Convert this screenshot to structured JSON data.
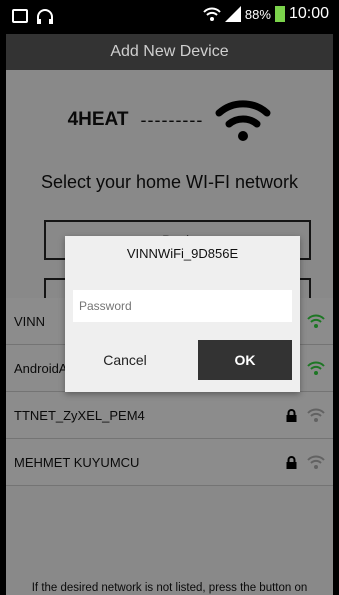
{
  "status_bar": {
    "battery": "88%",
    "time": "10:00",
    "icons": [
      "picture-icon",
      "headset-icon",
      "wifi-icon",
      "signal-icon",
      "battery-icon"
    ]
  },
  "app_bar": {
    "title": "Add New Device"
  },
  "header": {
    "brand": "4HEAT",
    "dashes": "---------",
    "wifi_icon": "wifi-icon"
  },
  "prompt": "Select your home WI-FI network",
  "buttons": {
    "first": "Back",
    "second": ""
  },
  "networks": [
    {
      "name": "VINN",
      "locked": true,
      "signal_color": "#2fbf3a"
    },
    {
      "name": "AndroidAP",
      "locked": true,
      "signal_color": "#2fbf3a"
    },
    {
      "name": "TTNET_ZyXEL_PEM4",
      "locked": true,
      "signal_color": "#9e9e9e"
    },
    {
      "name": "MEHMET KUYUMCU",
      "locked": true,
      "signal_color": "#9e9e9e"
    }
  ],
  "footer": "If the desired network is not listed, press the button on",
  "dialog": {
    "title": "VINNWiFi_9D856E",
    "password_placeholder": "Password",
    "cancel": "Cancel",
    "ok": "OK"
  }
}
